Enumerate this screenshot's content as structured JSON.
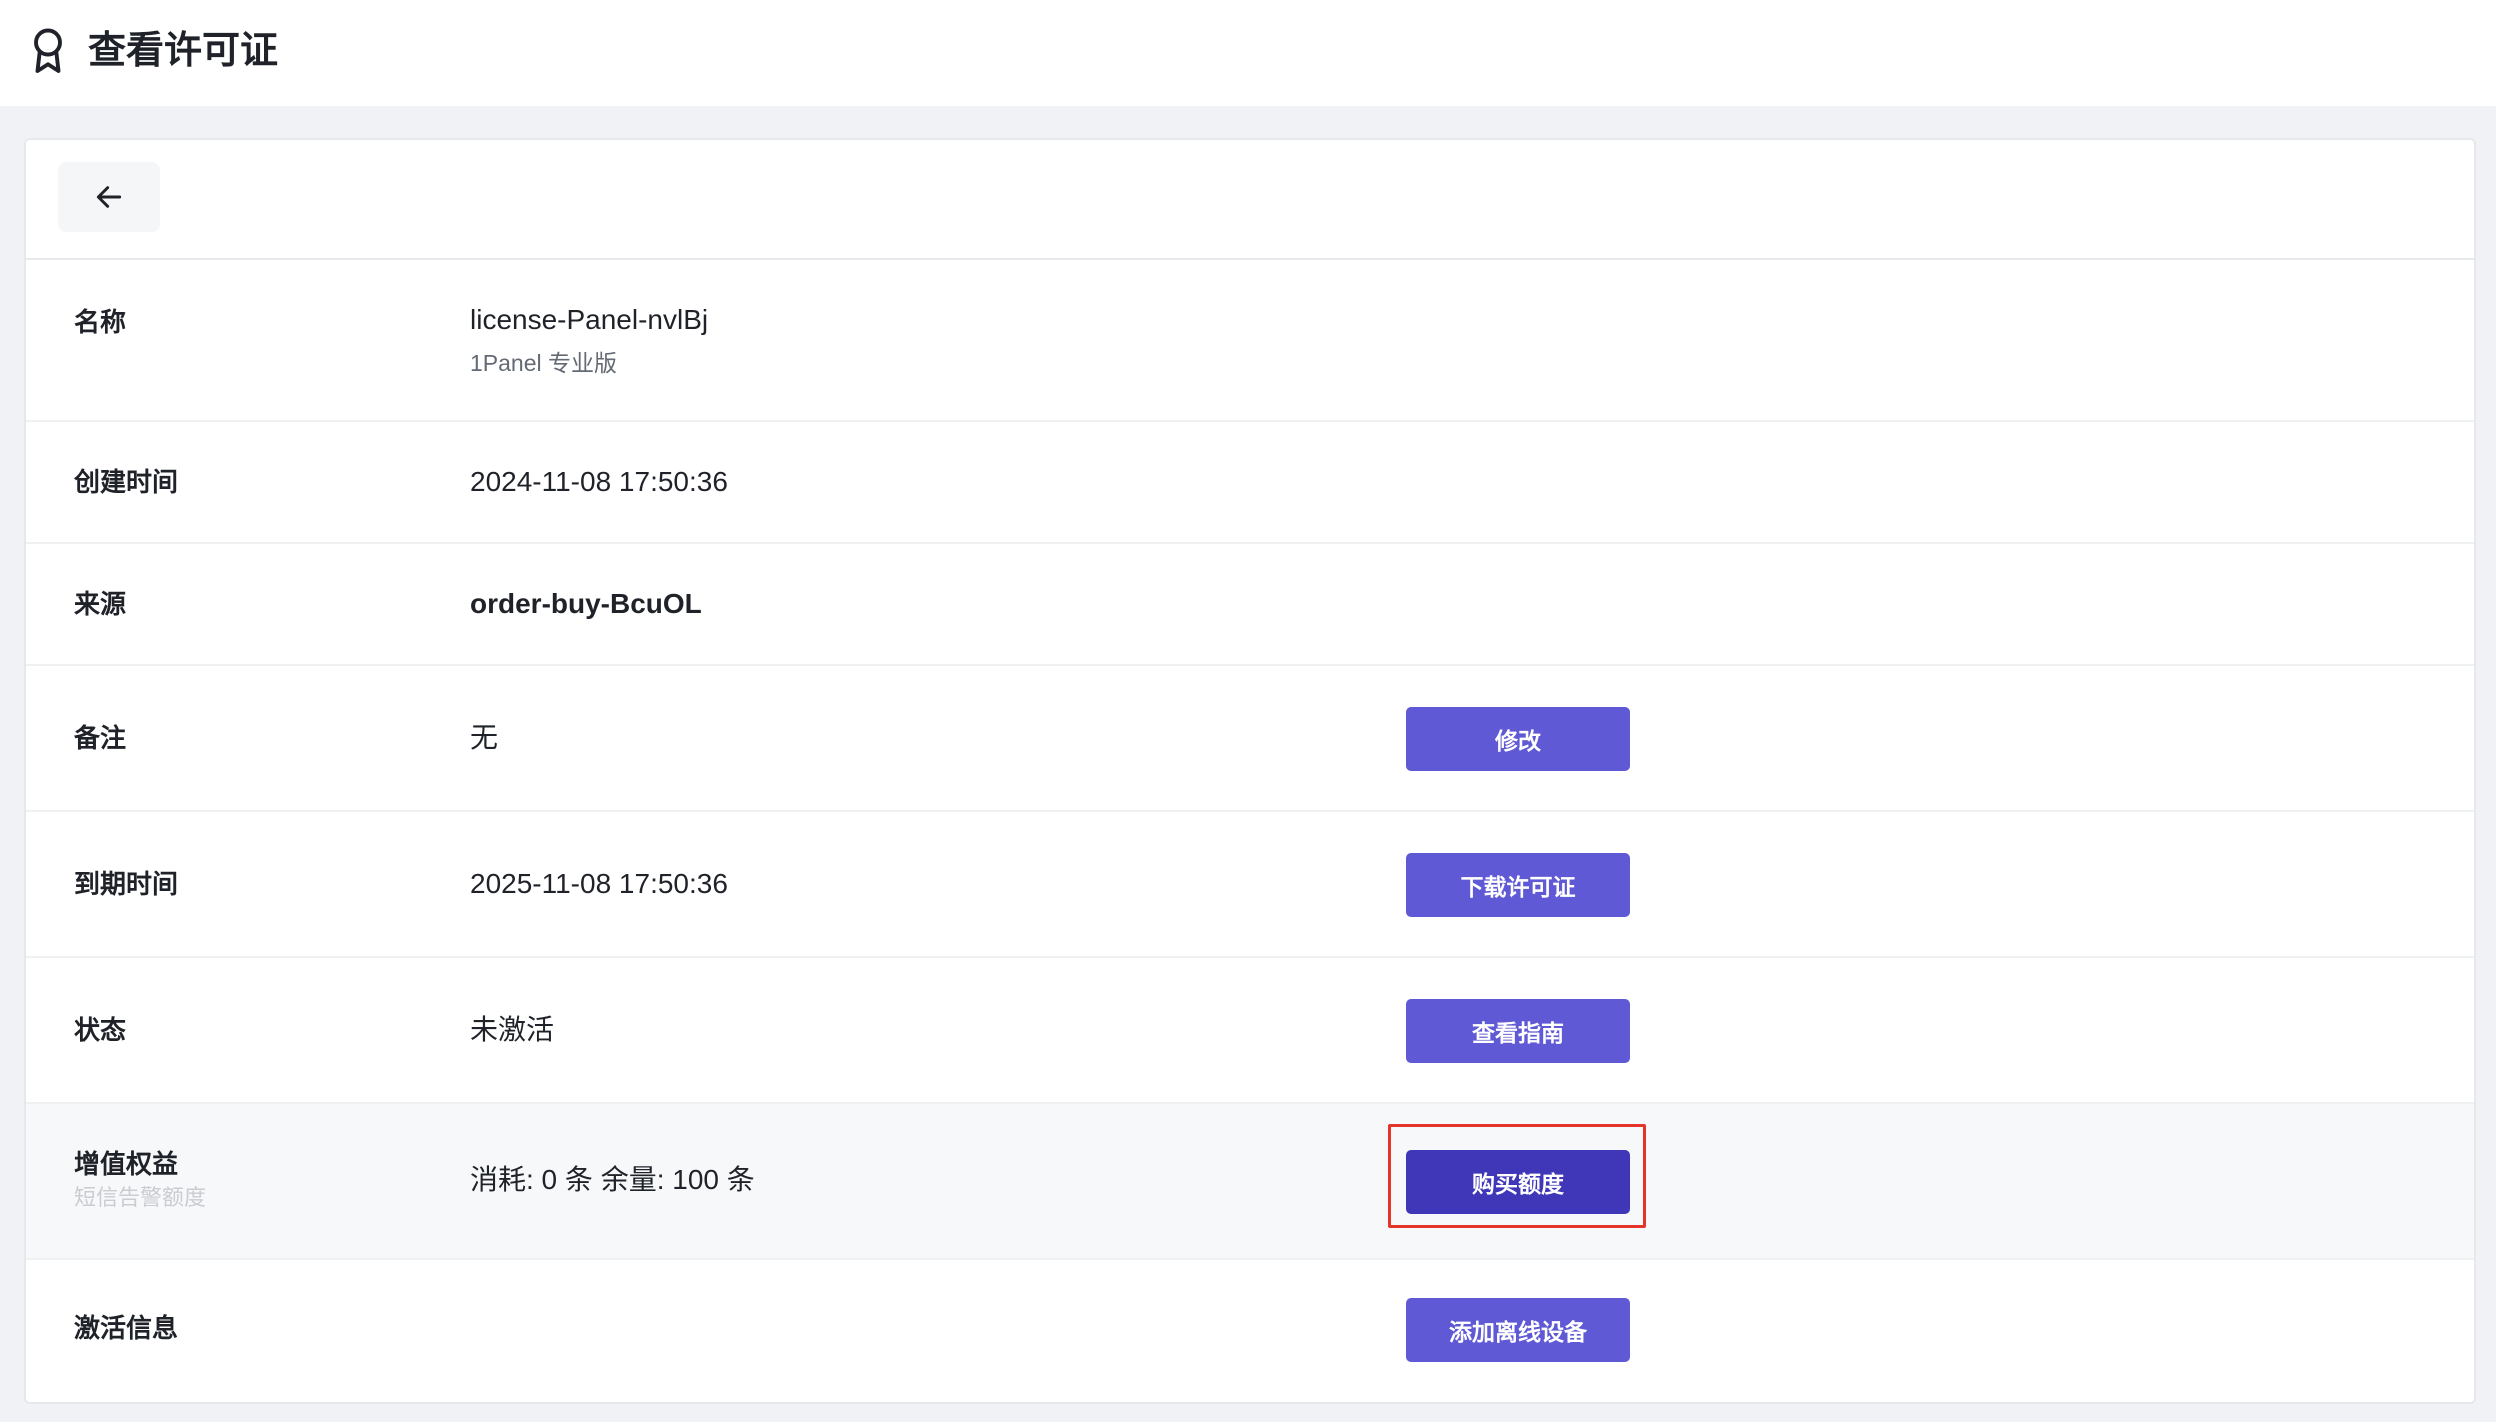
{
  "header": {
    "title": "查看许可证",
    "icon": "award-ribbon-icon"
  },
  "toolbar": {
    "back_icon": "arrow-left-icon"
  },
  "rows": [
    {
      "label": "名称",
      "value": "license-Panel-nvlBj",
      "subvalue": "1Panel 专业版"
    },
    {
      "label": "创建时间",
      "value": "2024-11-08 17:50:36"
    },
    {
      "label": "来源",
      "value": "order-buy-BcuOL"
    },
    {
      "label": "备注",
      "value": "无",
      "button": "修改"
    },
    {
      "label": "到期时间",
      "value": "2025-11-08 17:50:36",
      "button": "下载许可证"
    },
    {
      "label": "状态",
      "value": "未激活",
      "button": "查看指南"
    },
    {
      "label": "增值权益",
      "sublabel": "短信告警额度",
      "value": "消耗: 0 条 余量: 100 条",
      "button": "购买额度"
    },
    {
      "label": "激活信息",
      "value": "",
      "button": "添加离线设备"
    }
  ],
  "colors": {
    "primary": "#6059d6",
    "primary_active": "#3f37b8",
    "highlight_border": "#e5352b",
    "page_bg": "#f0f2f5"
  }
}
